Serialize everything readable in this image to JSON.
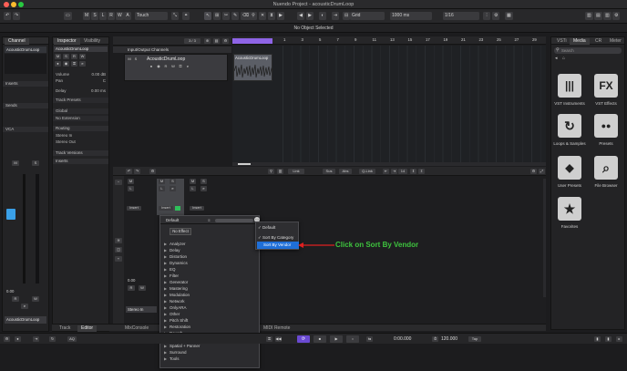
{
  "window": {
    "title": "Nuendo Project - acousticDrumLoop"
  },
  "toolbar": {
    "buttons": [
      "M",
      "S",
      "L",
      "R",
      "W",
      "A"
    ],
    "mode_select": "Touch",
    "grid_select": "Grid",
    "length_select": "1000 ms",
    "quantize_select": "1/16"
  },
  "status": {
    "message": "No Object Selected"
  },
  "left_zone": {
    "tabs": [
      "Channel"
    ],
    "channel_name": "AcousticDrumLoop",
    "sections": [
      "Inserts",
      "Sends",
      "VCA"
    ],
    "fader_value": "0.00",
    "buttons": [
      "M",
      "S",
      "L",
      "R",
      "W",
      "e"
    ],
    "bottom_name": "AcousticDrumLoop",
    "bottom_tabs": [
      "Track",
      "Editor"
    ]
  },
  "inspector": {
    "tabs": [
      "Inspector",
      "Visibility"
    ],
    "track_name": "AcousticDrumLoop",
    "rows": [
      "Volume",
      "Pan",
      "Delay",
      "Track Presets",
      "Global",
      "No Extension"
    ],
    "volume_value": "0.00 dB",
    "pan_value": "C",
    "delay_value": "0.00 ms",
    "routing_section": "Routing",
    "routing_rows": [
      "Stereo In",
      "Stereo Out"
    ],
    "sub_sections": [
      "Track Versions",
      "Inserts"
    ]
  },
  "project": {
    "counter": "3 / 3",
    "folder_name": "Input/Output Channels",
    "track_name": "AcousticDrumLoop",
    "clip_name": "AcousticDrumLoop",
    "ruler": [
      "1",
      "3",
      "5",
      "7",
      "9",
      "11",
      "13",
      "15",
      "17",
      "19",
      "21",
      "23",
      "25",
      "27",
      "29"
    ]
  },
  "lower_zone": {
    "toolbar_items": [
      "Link",
      "Sus",
      "Abs",
      "Q-Link",
      "14"
    ],
    "channel_buttons": [
      "M",
      "S",
      "L",
      "R",
      "W"
    ],
    "insert_slot": "Insert",
    "fader_value": "0.00",
    "routing_value": "Stereo In",
    "bottom_tabs": [
      "MixConsole",
      "MIDI Remote"
    ]
  },
  "plugin_menu": {
    "header": "Default",
    "no_effect": "No Effect",
    "categories": [
      "Analyzer",
      "Delay",
      "Distortion",
      "Dynamics",
      "EQ",
      "Filter",
      "Generator",
      "Mastering",
      "Modulation",
      "Network",
      "OnlyARA",
      "Other",
      "Pitch Shift",
      "Restoration",
      "Reverb",
      "Spatial",
      "Spatial + Panner",
      "Surround",
      "Tools"
    ]
  },
  "context_menu": {
    "items": [
      "Default",
      "Sort By Category",
      "Sort By Vendor"
    ],
    "checked": [
      "Default",
      "Sort By Category"
    ],
    "highlighted": "Sort By Vendor"
  },
  "annotation": {
    "text": "Click on Sort By Vendor",
    "color": "#3ec43e"
  },
  "media": {
    "tabs": [
      "VSTi",
      "Media",
      "CR",
      "Meter"
    ],
    "search_placeholder": "Search",
    "tiles": [
      {
        "icon": "vst-instruments-icon",
        "glyph": "|||",
        "label": "VST Instruments"
      },
      {
        "icon": "vst-effects-icon",
        "glyph": "FX",
        "label": "VST Effects"
      },
      {
        "icon": "loops-samples-icon",
        "glyph": "↻",
        "label": "Loops & Samples"
      },
      {
        "icon": "presets-icon",
        "glyph": "●●",
        "label": "Presets"
      },
      {
        "icon": "user-presets-icon",
        "glyph": "◆",
        "label": "User Presets"
      },
      {
        "icon": "file-browser-icon",
        "glyph": "⌕",
        "label": "File Browser"
      },
      {
        "icon": "favorites-icon",
        "glyph": "★",
        "label": "Favorites"
      }
    ]
  },
  "transport": {
    "position": "0:00.000",
    "tempo": "120.000",
    "tap": "Tap",
    "aq": "AQ"
  },
  "colors": {
    "accent": "#1f6fd8",
    "track_purple": "#9a6cf0",
    "annotation_green": "#3ec43e"
  }
}
